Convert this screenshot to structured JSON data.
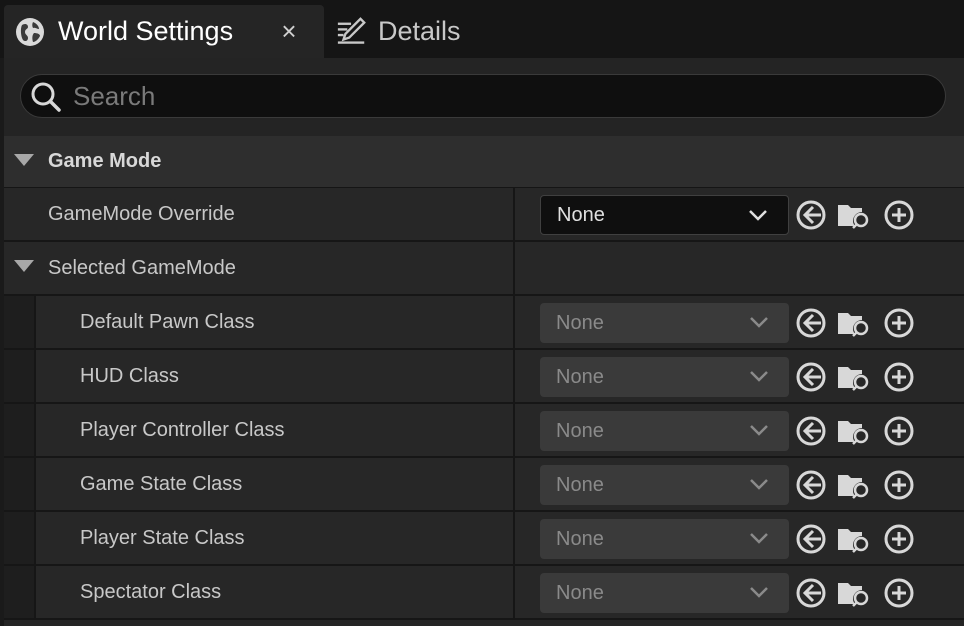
{
  "tabs": [
    {
      "label": "World Settings",
      "icon": "globe-icon",
      "active": true,
      "close": "×"
    },
    {
      "label": "Details",
      "icon": "details-edit-icon",
      "active": false
    }
  ],
  "search": {
    "placeholder": "Search",
    "value": ""
  },
  "category": {
    "label": "Game Mode",
    "expanded": true
  },
  "gamemode_override": {
    "label": "GameMode Override",
    "value": "None"
  },
  "selected_gamemode": {
    "label": "Selected GameMode",
    "expanded": true,
    "items": [
      {
        "label": "Default Pawn Class",
        "value": "None"
      },
      {
        "label": "HUD Class",
        "value": "None"
      },
      {
        "label": "Player Controller Class",
        "value": "None"
      },
      {
        "label": "Game State Class",
        "value": "None"
      },
      {
        "label": "Player State Class",
        "value": "None"
      },
      {
        "label": "Spectator Class",
        "value": "None"
      }
    ]
  },
  "colors": {
    "background": "#1a1a1a",
    "panel": "#252525",
    "icon": "#d8d8d8"
  }
}
